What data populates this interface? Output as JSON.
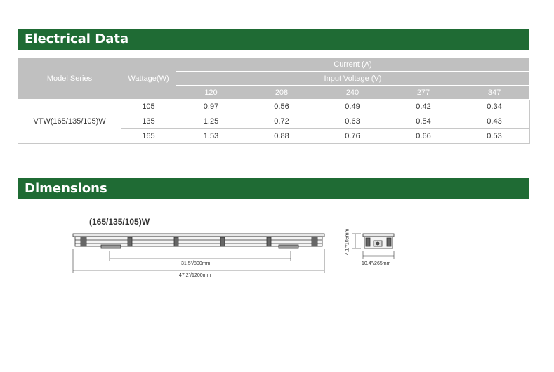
{
  "electrical": {
    "title": "Electrical Data",
    "headers": {
      "model_series": "Model Series",
      "wattage": "Wattage(W)",
      "current": "Current (A)",
      "input_voltage": "Input Voltage (V)",
      "voltages": [
        "120",
        "208",
        "240",
        "277",
        "347"
      ]
    },
    "model": "VTW(165/135/105)W",
    "rows": [
      {
        "wattage": "105",
        "values": [
          "0.97",
          "0.56",
          "0.49",
          "0.42",
          "0.34"
        ]
      },
      {
        "wattage": "135",
        "values": [
          "1.25",
          "0.72",
          "0.63",
          "0.54",
          "0.43"
        ]
      },
      {
        "wattage": "165",
        "values": [
          "1.53",
          "0.88",
          "0.76",
          "0.66",
          "0.53"
        ]
      }
    ]
  },
  "dimensions": {
    "title": "Dimensions",
    "model_label": "(165/135/105)W",
    "inner_length": "31.5\"/800mm",
    "overall_length": "47.2\"/1200mm",
    "height": "4.1\"/105mm",
    "width": "10.4\"/265mm"
  },
  "colors": {
    "banner": "#1f6b34",
    "header_bg": "#c0c0c0"
  }
}
